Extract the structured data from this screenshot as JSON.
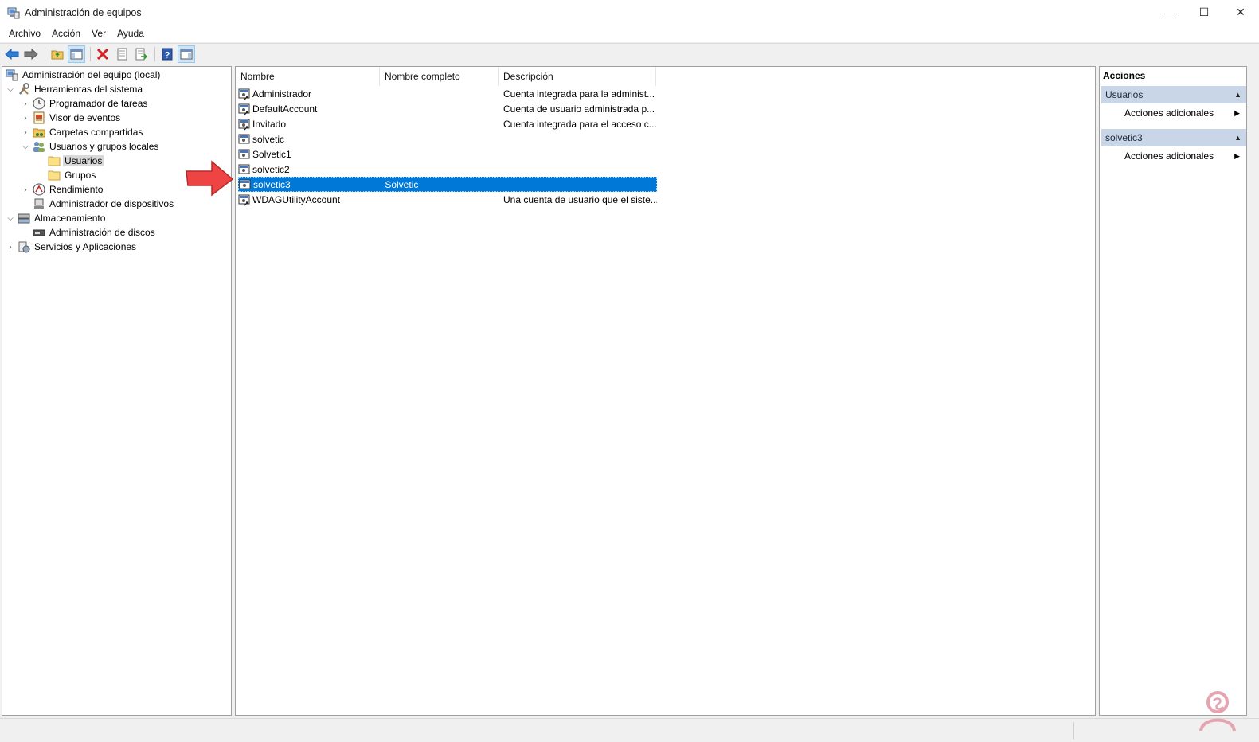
{
  "window": {
    "title": "Administración de equipos",
    "minimize_glyph": "—",
    "maximize_glyph": "☐",
    "close_glyph": "✕"
  },
  "menu": [
    "Archivo",
    "Acción",
    "Ver",
    "Ayuda"
  ],
  "toolbar": {
    "buttons": [
      "back-arrow-icon",
      "forward-arrow-icon",
      "up-folder-icon",
      "show-hide-tree-icon",
      "delete-icon",
      "properties-icon",
      "export-list-icon",
      "help-icon",
      "show-hide-action-pane-icon"
    ]
  },
  "tree": {
    "root": "Administración del equipo (local)",
    "system_tools": "Herramientas del sistema",
    "task_scheduler": "Programador de tareas",
    "event_viewer": "Visor de eventos",
    "shared_folders": "Carpetas compartidas",
    "local_users_groups": "Usuarios y grupos locales",
    "users": "Usuarios",
    "groups": "Grupos",
    "performance": "Rendimiento",
    "device_manager": "Administrador de dispositivos",
    "storage": "Almacenamiento",
    "disk_management": "Administración de discos",
    "services_apps": "Servicios y Aplicaciones"
  },
  "list": {
    "columns": [
      "Nombre",
      "Nombre completo",
      "Descripción"
    ],
    "rows": [
      {
        "name": "Administrador",
        "full_name": "",
        "description": "Cuenta integrada para la administ..."
      },
      {
        "name": "DefaultAccount",
        "full_name": "",
        "description": "Cuenta de usuario administrada p..."
      },
      {
        "name": "Invitado",
        "full_name": "",
        "description": "Cuenta integrada para el acceso c..."
      },
      {
        "name": "solvetic",
        "full_name": "",
        "description": ""
      },
      {
        "name": "Solvetic1",
        "full_name": "",
        "description": ""
      },
      {
        "name": "solvetic2",
        "full_name": "",
        "description": ""
      },
      {
        "name": "solvetic3",
        "full_name": "Solvetic",
        "description": ""
      },
      {
        "name": "WDAGUtilityAccount",
        "full_name": "",
        "description": "Una cuenta de usuario que el siste..."
      }
    ],
    "selected_row": "solvetic3"
  },
  "actions": {
    "title": "Acciones",
    "group1": "Usuarios",
    "group1_item": "Acciones adicionales",
    "group2": "solvetic3",
    "group2_item": "Acciones adicionales"
  },
  "colors": {
    "selection": "#0078d7",
    "action_group_bg": "#c9d6e8",
    "annotation_arrow": "#ee4444"
  }
}
